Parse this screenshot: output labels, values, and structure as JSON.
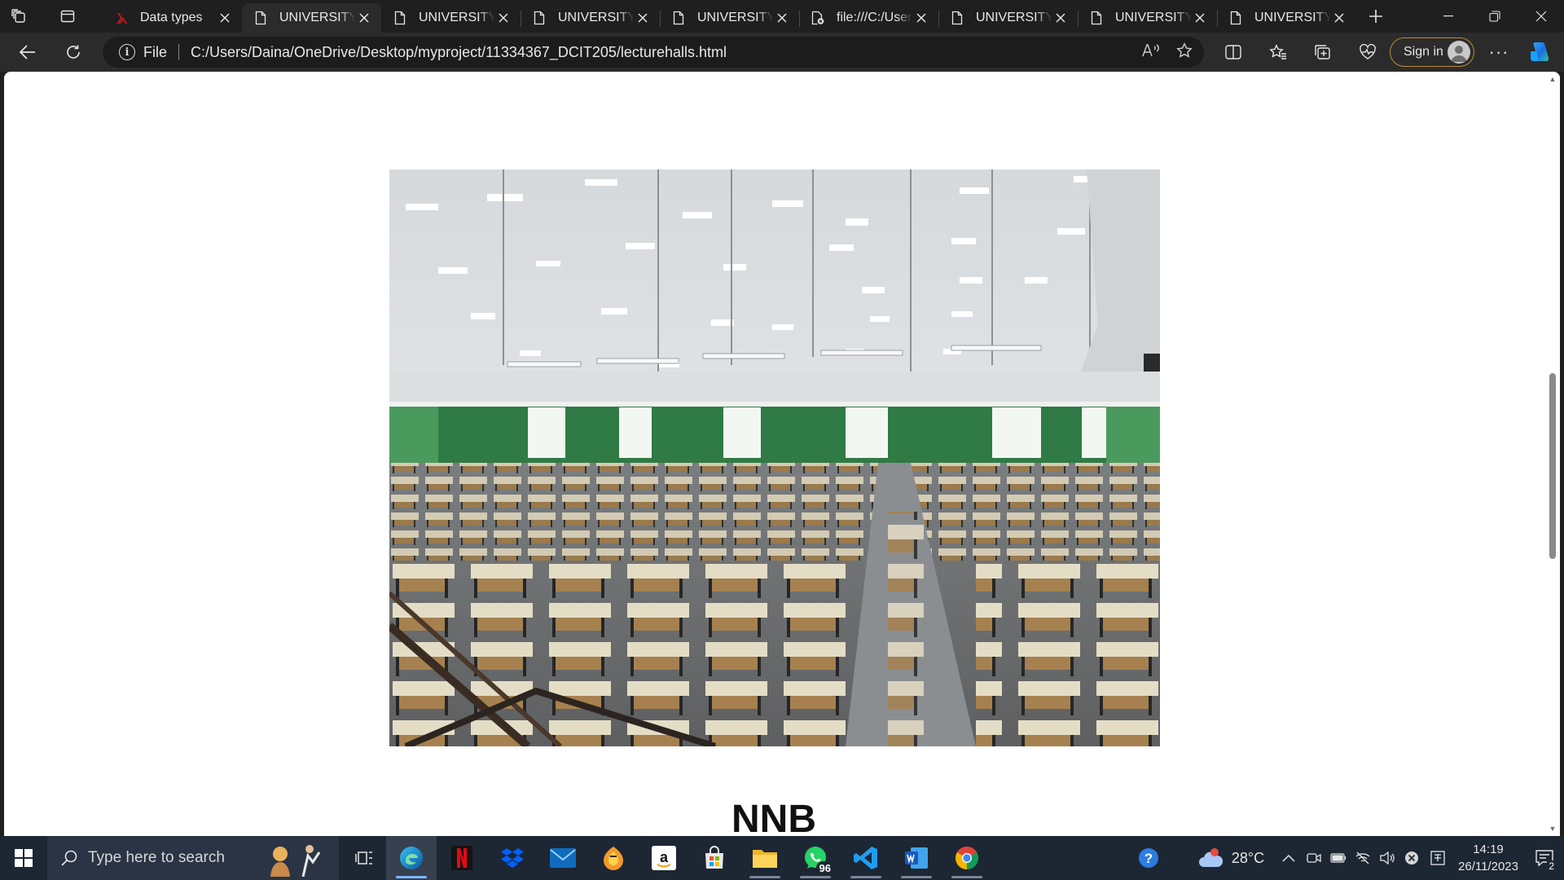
{
  "browser": {
    "tabs": [
      {
        "title": "Data types",
        "icon": "data-types-favicon",
        "active": false
      },
      {
        "title": "UNIVERSITY OF GHANA",
        "icon": "document-icon",
        "active": true
      },
      {
        "title": "UNIVERSITY OF GHANA",
        "icon": "document-icon",
        "active": false
      },
      {
        "title": "UNIVERSITY OF GHANA",
        "icon": "document-icon",
        "active": false
      },
      {
        "title": "UNIVERSITY OF GHANA",
        "icon": "document-icon",
        "active": false
      },
      {
        "title": "file:///C:/Users/",
        "icon": "broken-file-icon",
        "active": false
      },
      {
        "title": "UNIVERSITY OF GHANA",
        "icon": "document-icon",
        "active": false
      },
      {
        "title": "UNIVERSITY OF GHANA",
        "icon": "document-icon",
        "active": false
      },
      {
        "title": "UNIVERSITY OF GHANA",
        "icon": "document-icon",
        "active": false
      }
    ],
    "address": {
      "scheme_label": "File",
      "url": "C:/Users/Daina/OneDrive/Desktop/myproject/11334367_DCIT205/lecturehalls.html"
    },
    "sign_in_label": "Sign in",
    "more_label": "···"
  },
  "page": {
    "image_alt": "Lecture hall with rows of desks",
    "heading": "NNB"
  },
  "taskbar": {
    "search_placeholder": "Type here to search",
    "apps": [
      {
        "name": "edge",
        "running": true,
        "current": true
      },
      {
        "name": "netflix",
        "running": false
      },
      {
        "name": "dropbox",
        "running": false
      },
      {
        "name": "mail",
        "running": false
      },
      {
        "name": "fl-studio",
        "running": false
      },
      {
        "name": "amazon",
        "running": false
      },
      {
        "name": "microsoft-store",
        "running": false
      },
      {
        "name": "file-explorer",
        "running": true
      },
      {
        "name": "whatsapp",
        "running": true,
        "badge": "96"
      },
      {
        "name": "vscode",
        "running": true
      },
      {
        "name": "word",
        "running": true
      },
      {
        "name": "chrome",
        "running": true
      }
    ],
    "weather": {
      "temp": "28°C",
      "alert": "1"
    },
    "clock": {
      "time": "14:19",
      "date": "26/11/2023"
    },
    "notifications_count": "2"
  },
  "colors": {
    "chrome_dark": "#1f1f1f",
    "toolbar": "#2b2b2b",
    "taskbar": "#1d2633",
    "signin_border": "#b88f36"
  }
}
